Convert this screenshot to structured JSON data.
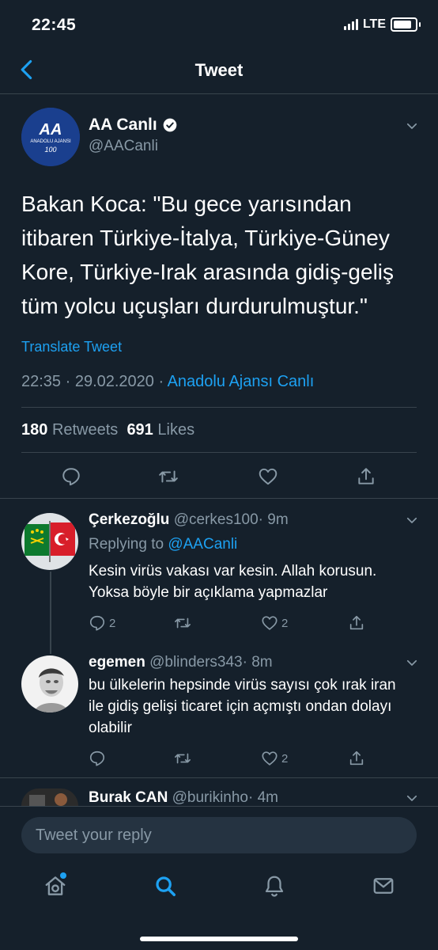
{
  "status_bar": {
    "time": "22:45",
    "network": "LTE"
  },
  "header": {
    "title": "Tweet"
  },
  "tweet": {
    "author_name": "AA Canlı",
    "author_handle": "@AACanli",
    "verified": true,
    "avatar_text_top": "AA",
    "avatar_text_mid": "ANADOLU AJANSI",
    "avatar_text_bot": "100",
    "text": "Bakan Koca: \"Bu gece yarısından itibaren Türkiye-İtalya, Türkiye-Güney Kore, Türkiye-Irak arasında gidiş-geliş tüm yolcu uçuşları durdurulmuştur.\"",
    "translate_label": "Translate Tweet",
    "timestamp": "22:35 · 29.02.2020 · ",
    "source": "Anadolu Ajansı Canlı",
    "retweets_count": "180",
    "retweets_label": "Retweets",
    "likes_count": "691",
    "likes_label": "Likes"
  },
  "replies": [
    {
      "name": "Çerkezoğlu",
      "handle": "@cerkes100",
      "time": "· 9m",
      "replying_prefix": "Replying to ",
      "replying_to": "@AACanli",
      "text": "Kesin virüs vakası var kesin. Allah korusun. Yoksa böyle bir açıklama yapmazlar",
      "reply_count": "2",
      "like_count": "2"
    },
    {
      "name": "egemen",
      "handle": "@blinders343",
      "time": "· 8m",
      "text": "bu ülkelerin hepsinde virüs sayısı çok ırak iran ile gidiş gelişi ticaret için açmıştı ondan dolayı olabilir",
      "like_count": "2"
    },
    {
      "name": "Burak CAN",
      "handle": "@burikinho",
      "time": "· 4m"
    }
  ],
  "composer": {
    "placeholder": "Tweet your reply"
  },
  "colors": {
    "background": "#15202b",
    "accent": "#1da1f2",
    "muted": "#8899a6",
    "divider": "#38444d"
  },
  "icons": [
    "back-chevron-icon",
    "verified-icon",
    "chevron-down-icon",
    "reply-icon",
    "retweet-icon",
    "like-icon",
    "share-icon",
    "home-icon",
    "search-icon",
    "notifications-icon",
    "messages-icon"
  ]
}
